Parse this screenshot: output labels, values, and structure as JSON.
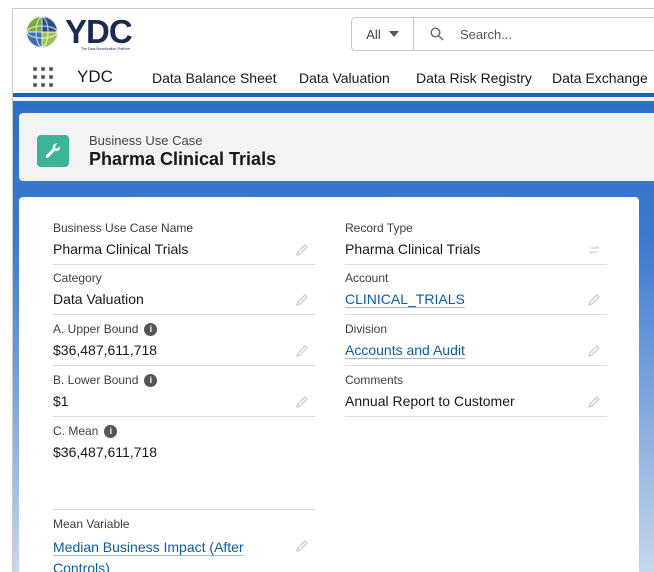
{
  "header": {
    "logo_text": "YDC",
    "logo_tagline": "The Data Monetization Platform",
    "search": {
      "scope": "All",
      "placeholder": "Search..."
    }
  },
  "nav": {
    "app_name": "YDC",
    "items": [
      {
        "label": "Data Balance Sheet"
      },
      {
        "label": "Data Valuation"
      },
      {
        "label": "Data Risk Registry"
      },
      {
        "label": "Data Exchange"
      }
    ]
  },
  "record": {
    "object_type": "Business Use Case",
    "title": "Pharma Clinical Trials",
    "icon": "wrench-icon",
    "icon_color": "#3cb497"
  },
  "fields": {
    "left": [
      {
        "label": "Business Use Case Name",
        "value": "Pharma Clinical Trials"
      },
      {
        "label": "Category",
        "value": "Data Valuation"
      },
      {
        "label": "A. Upper Bound",
        "value": "$36,487,611,718"
      },
      {
        "label": "B. Lower Bound",
        "value": "$1"
      },
      {
        "label": "C. Mean",
        "value": "$36,487,611,718"
      },
      {
        "label": "Mean Variable",
        "value": "Median Business Impact (After Controls)"
      }
    ],
    "right": [
      {
        "label": "Record Type",
        "value": "Pharma Clinical Trials"
      },
      {
        "label": "Account",
        "value": "CLINICAL_TRIALS"
      },
      {
        "label": "Division",
        "value": "Accounts and Audit"
      },
      {
        "label": "Comments",
        "value": "Annual Report to Customer"
      }
    ]
  },
  "colors": {
    "brand_blue": "#1b5fbf",
    "link": "#0b5cab"
  }
}
